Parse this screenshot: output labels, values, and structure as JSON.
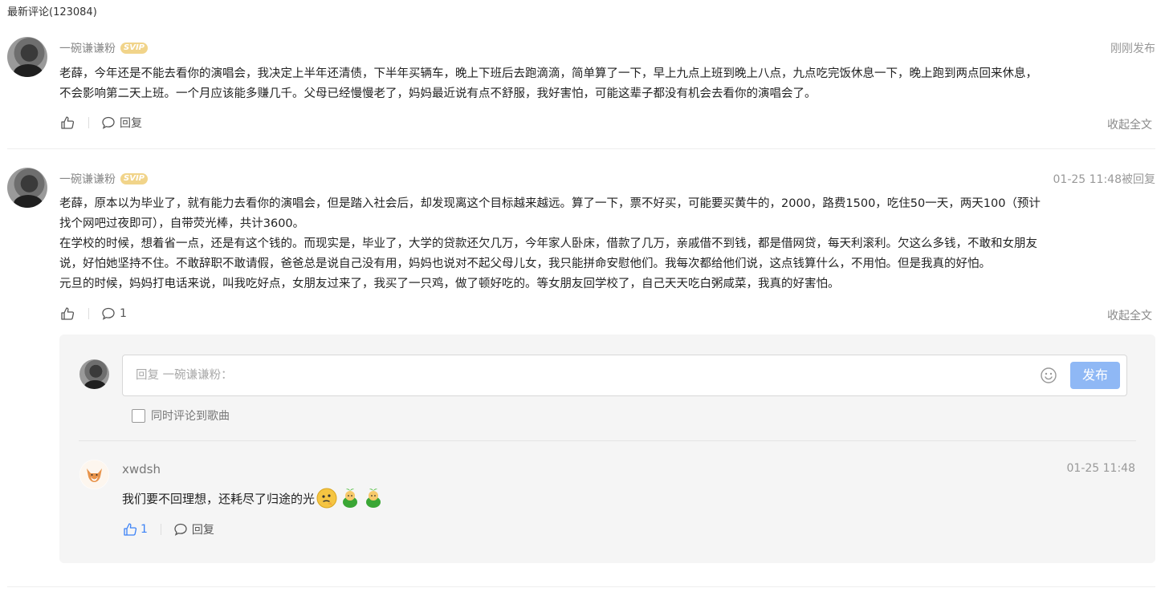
{
  "header": {
    "title": "最新评论(123084)"
  },
  "comments": [
    {
      "username": "一碗谦谦粉",
      "badge": "SVIP",
      "time": "刚刚发布",
      "lines": [
        "老薛，今年还是不能去看你的演唱会，我决定上半年还清债，下半年买辆车，晚上下班后去跑滴滴，简单算了一下，早上九点上班到晚上八点，九点吃完饭休息一下，晚上跑到两点回来休息，",
        "不会影响第二天上班。一个月应该能多赚几千。父母已经慢慢老了，妈妈最近说有点不舒服，我好害怕，可能这辈子都没有机会去看你的演唱会了。"
      ],
      "reply_label": "回复",
      "collapse_label": "收起全文"
    },
    {
      "username": "一碗谦谦粉",
      "badge": "SVIP",
      "time": "01-25 11:48被回复",
      "lines": [
        "老薛，原本以为毕业了，就有能力去看你的演唱会，但是踏入社会后，却发现离这个目标越来越远。算了一下，票不好买，可能要买黄牛的，2000，路费1500，吃住50一天，两天100（预计",
        "找个网吧过夜即可），自带荧光棒，共计3600。",
        "在学校的时候，想着省一点，还是有这个钱的。而现实是，毕业了，大学的贷款还欠几万，今年家人卧床，借款了几万，亲戚借不到钱，都是借网贷，每天利滚利。欠这么多钱，不敢和女朋友",
        "说，好怕她坚持不住。不敢辞职不敢请假，爸爸总是说自己没有用，妈妈也说对不起父母儿女，我只能拼命安慰他们。我每次都给他们说，这点钱算什么，不用怕。但是我真的好怕。",
        "元旦的时候，妈妈打电话来说，叫我吃好点，女朋友过来了，我买了一只鸡，做了顿好吃的。等女朋友回学校了，自己天天吃白粥咸菜，我真的好害怕。"
      ],
      "reply_count": "1",
      "collapse_label": "收起全文"
    }
  ],
  "reply_form": {
    "placeholder": "回复 一碗谦谦粉：",
    "publish_label": "发布",
    "sync_label": "同时评论到歌曲"
  },
  "sub_reply": {
    "username": "xwdsh",
    "time": "01-25 11:48",
    "text": "我们要不回理想，还耗尽了归途的光",
    "like_count": "1",
    "reply_label": "回复",
    "emojis": [
      "thinking-face-icon",
      "green-sprout-icon",
      "green-sprout-icon"
    ]
  },
  "colors": {
    "accent": "#3b82f6",
    "publish": "#8fb8f5",
    "svip": "#f1d48a"
  }
}
